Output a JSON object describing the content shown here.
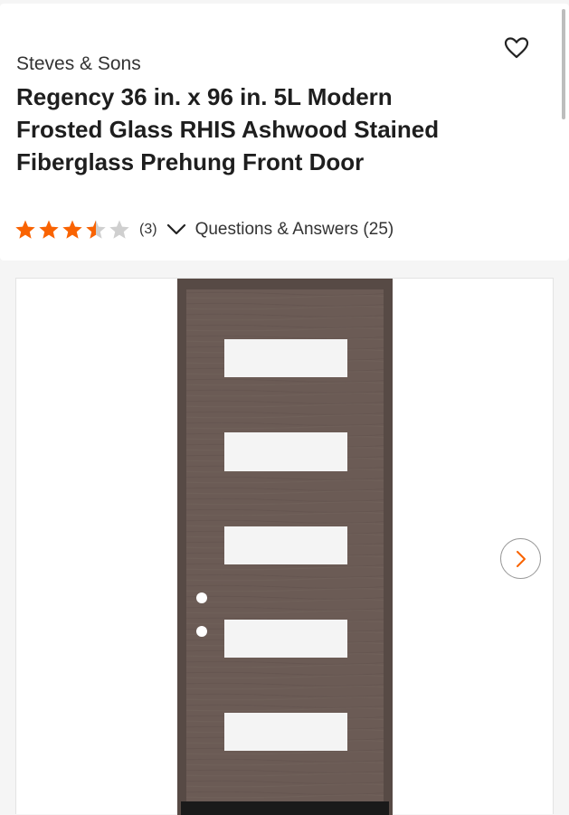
{
  "product": {
    "brand": "Steves & Sons",
    "title": "Regency 36 in. x 96 in. 5L Modern Frosted Glass RHIS Ashwood Stained Fiberglass Prehung Front Door",
    "rating": 3.5,
    "rating_max": 5,
    "review_count": "(3)",
    "qa_label": "Questions & Answers (25)"
  },
  "icons": {
    "favorite": "heart-outline-icon",
    "expand": "chevron-down-icon",
    "next": "chevron-right-icon"
  },
  "colors": {
    "star": "#f96302",
    "star_empty": "#cfcfcf",
    "door_frame": "#574a45",
    "door_panel": "#6b5b55",
    "glass": "#f4f4f4",
    "next_chevron": "#f96302"
  }
}
